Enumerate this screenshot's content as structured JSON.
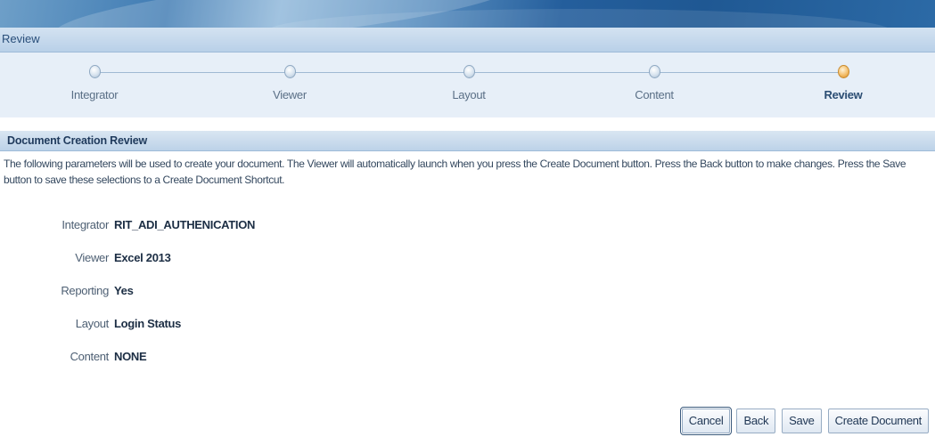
{
  "page": {
    "title": "Review"
  },
  "train": {
    "steps": [
      {
        "label": "Integrator",
        "state": "complete"
      },
      {
        "label": "Viewer",
        "state": "complete"
      },
      {
        "label": "Layout",
        "state": "complete"
      },
      {
        "label": "Content",
        "state": "complete"
      },
      {
        "label": "Review",
        "state": "current"
      }
    ]
  },
  "section": {
    "title": "Document Creation Review",
    "instructions": "The following parameters will be used to create your document. The Viewer will automatically launch when you press the Create Document button. Press the Back button to make changes. Press the Save button to save these selections to a Create Document Shortcut."
  },
  "fields": [
    {
      "label": "Integrator",
      "value": "RIT_ADI_AUTHENICATION"
    },
    {
      "label": "Viewer",
      "value": "Excel 2013"
    },
    {
      "label": "Reporting",
      "value": "Yes"
    },
    {
      "label": "Layout",
      "value": "Login Status"
    },
    {
      "label": "Content",
      "value": "NONE"
    }
  ],
  "buttons": {
    "cancel": "Cancel",
    "back": "Back",
    "save": "Save",
    "create_document": "Create Document"
  },
  "colors": {
    "banner": "#245e9c",
    "header_band": "#c7dbee",
    "active_step": "#f3be6b"
  }
}
